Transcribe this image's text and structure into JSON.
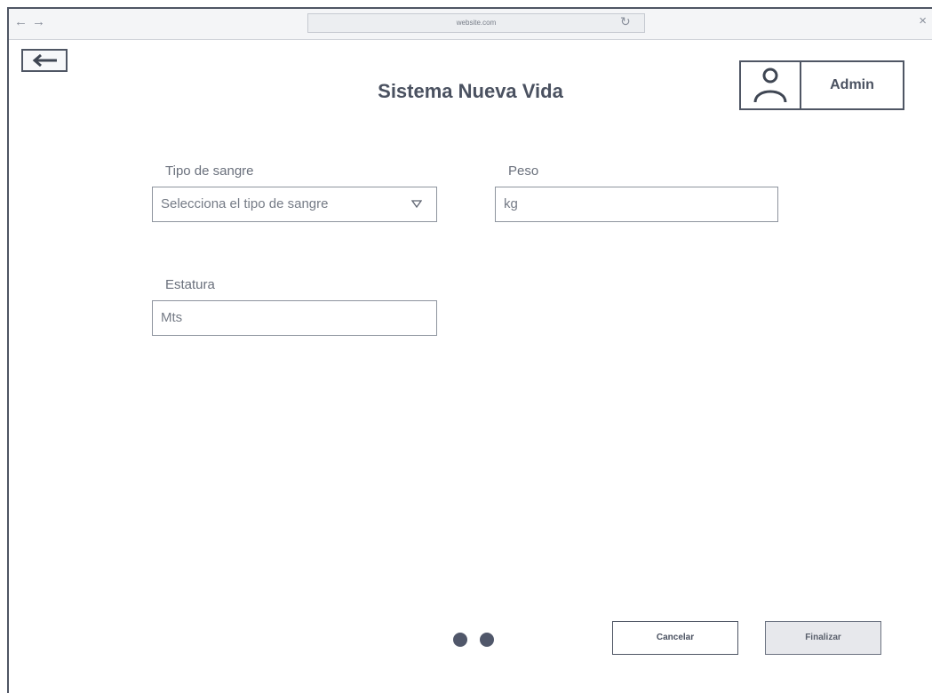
{
  "browser": {
    "url": "website.com",
    "back_glyph": "←",
    "forward_glyph": "→",
    "reload_glyph": "↻",
    "close_glyph": "×"
  },
  "header": {
    "title": "Sistema Nueva Vida",
    "back_icon": "arrow-left-icon",
    "user": {
      "name": "Admin",
      "icon": "user-icon"
    }
  },
  "form": {
    "blood_type": {
      "label": "Tipo de sangre",
      "placeholder": "Selecciona el tipo de sangre",
      "icon": "chevron-down-icon"
    },
    "weight": {
      "label": "Peso",
      "placeholder": "kg"
    },
    "height": {
      "label": "Estatura",
      "placeholder": "Mts"
    }
  },
  "footer": {
    "pagination_dots": 2,
    "cancel_label": "Cancelar",
    "finish_label": "Finalizar"
  },
  "colors": {
    "stroke": "#4f5664",
    "text": "#4a5160",
    "finish_bg": "#e7e8ec"
  }
}
